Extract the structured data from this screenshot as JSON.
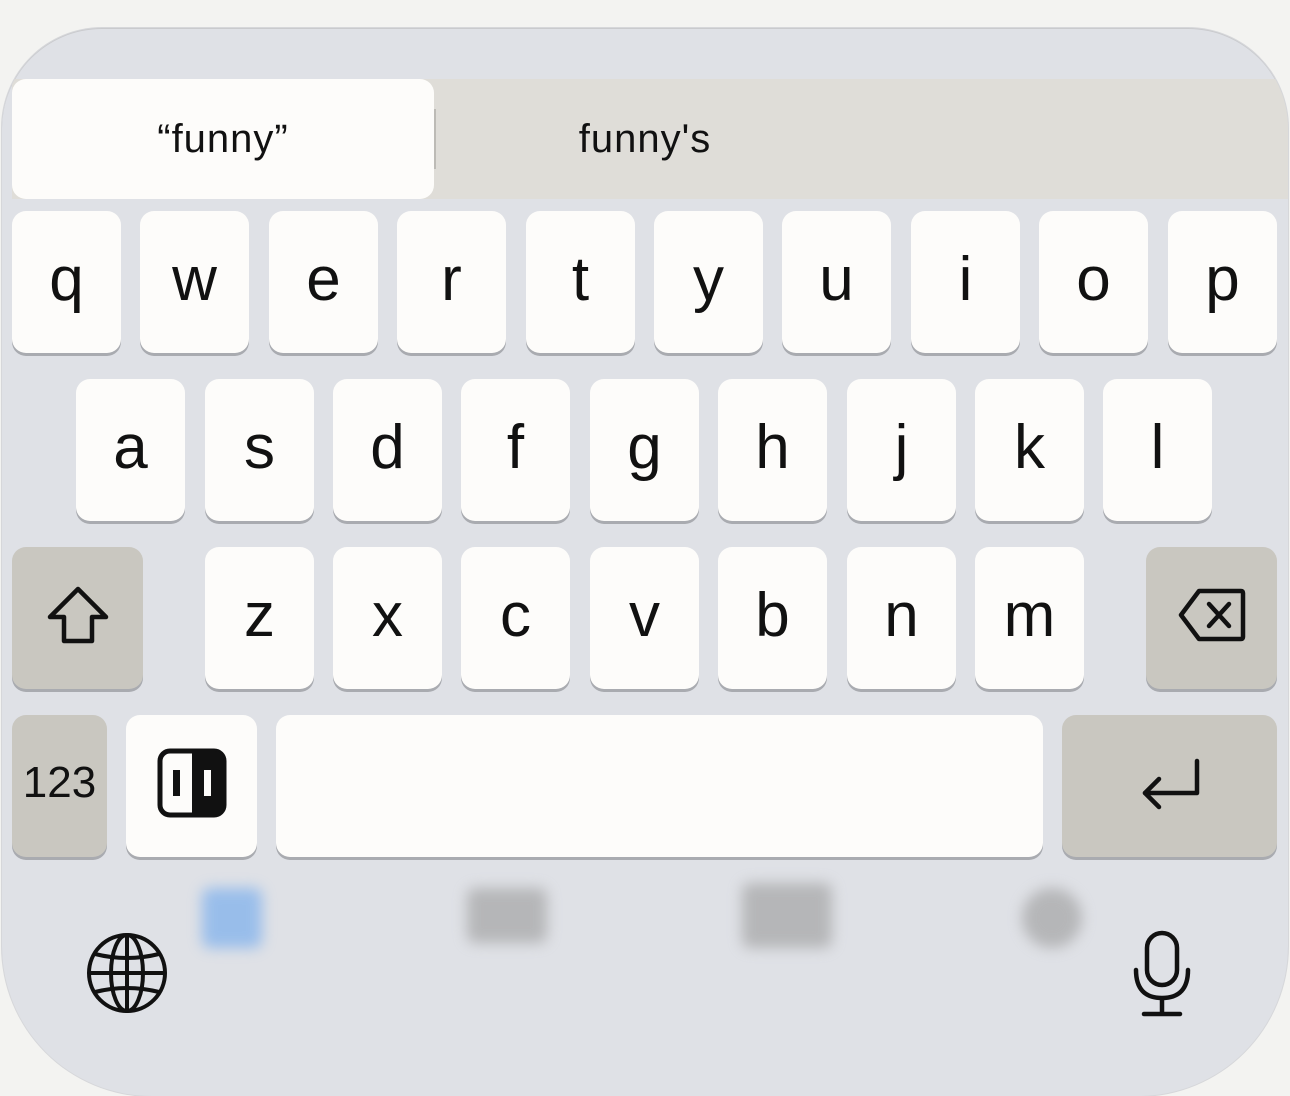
{
  "suggestions": {
    "primary": "“funny”",
    "secondary": "funny's"
  },
  "rows": {
    "row1": [
      "q",
      "w",
      "e",
      "r",
      "t",
      "y",
      "u",
      "i",
      "o",
      "p"
    ],
    "row2": [
      "a",
      "s",
      "d",
      "f",
      "g",
      "h",
      "j",
      "k",
      "l"
    ],
    "row3": [
      "z",
      "x",
      "c",
      "v",
      "b",
      "n",
      "m"
    ]
  },
  "bottom": {
    "numbers_label": "123",
    "shift_icon": "shift-icon",
    "delete_icon": "delete-icon",
    "emoji_icon": "emoji-keyboard-icon",
    "return_icon": "return-icon",
    "globe_icon": "globe-icon",
    "mic_icon": "microphone-icon"
  },
  "colors": {
    "keyboard_bg": "#dfe1e6",
    "key_bg": "#fdfcfa",
    "function_key_bg": "#c9c7c0",
    "background_tab_accent": "#4a90e2"
  }
}
